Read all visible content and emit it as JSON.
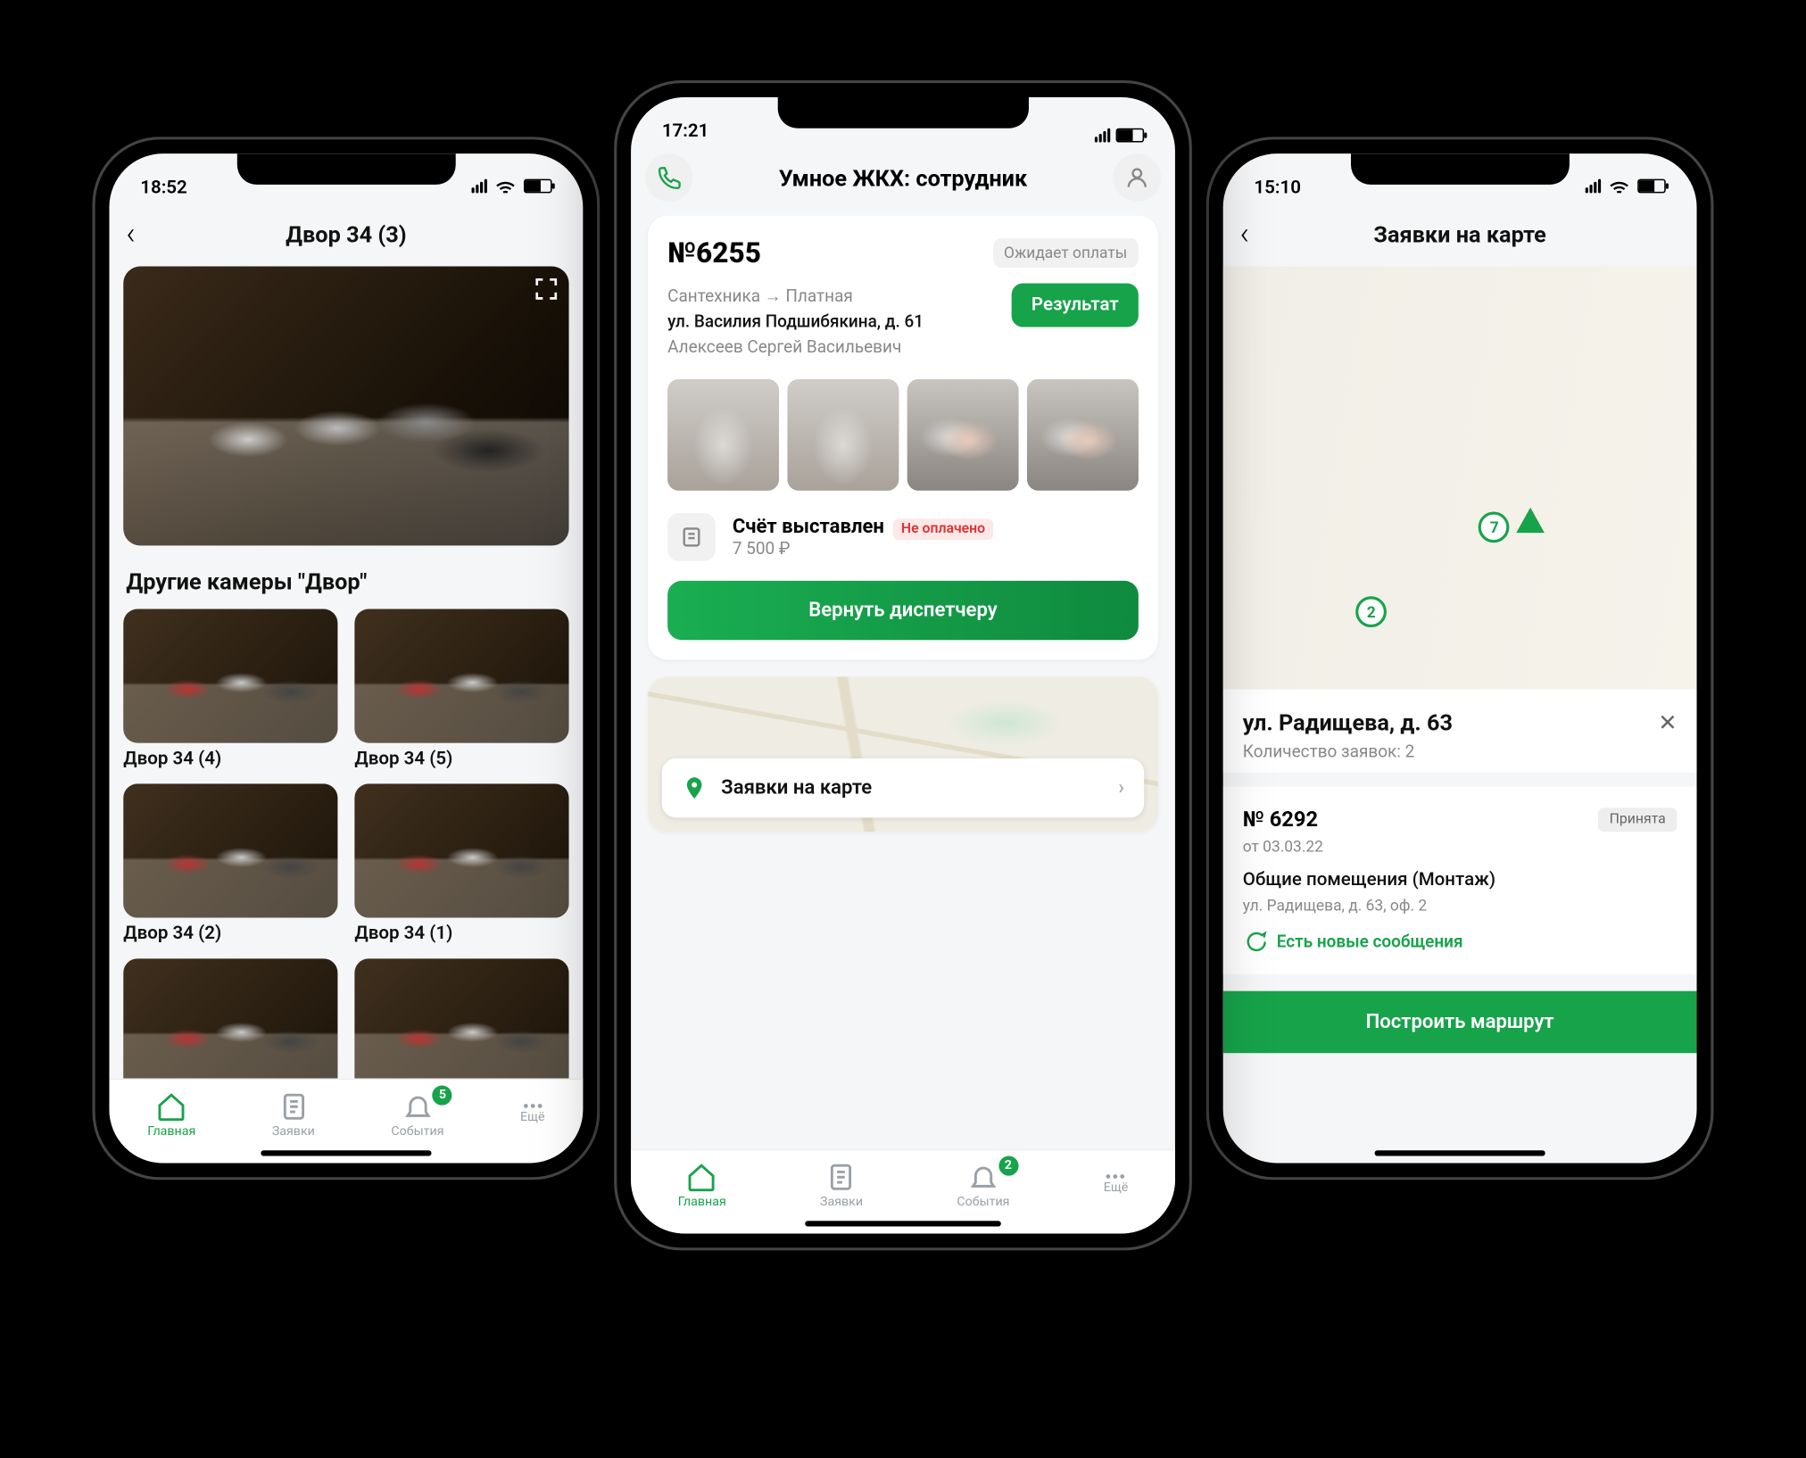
{
  "left": {
    "status_time": "18:52",
    "nav_title": "Двор 34 (3)",
    "section_title": "Другие камеры \"Двор\"",
    "cams": [
      {
        "label": "Двор 34 (4)"
      },
      {
        "label": "Двор 34 (5)"
      },
      {
        "label": "Двор 34 (2)"
      },
      {
        "label": "Двор 34 (1)"
      }
    ],
    "tabs": {
      "home": "Главная",
      "req": "Заявки",
      "events": "События",
      "more": "Ещё",
      "badge": "5"
    }
  },
  "center": {
    "status_time": "17:21",
    "header_title": "Умное ЖКХ: сотрудник",
    "ticket_no": "№6255",
    "ticket_status": "Ожидает оплаты",
    "category_line": "Сантехника → Платная",
    "address": "ул. Василия Подшибякина, д. 61",
    "person": "Алексеев Сергей Васильевич",
    "result_btn": "Результат",
    "bill_title": "Счёт выставлен",
    "bill_amount": "7 500 ₽",
    "bill_badge": "Не оплачено",
    "return_btn": "Вернуть диспетчеру",
    "map_btn": "Заявки на карте",
    "tabs": {
      "home": "Главная",
      "req": "Заявки",
      "events": "События",
      "more": "Ещё",
      "badge": "2"
    }
  },
  "right": {
    "status_time": "15:10",
    "nav_title": "Заявки на карте",
    "map_markers": [
      "7",
      "2"
    ],
    "addr_title": "ул. Радищева, д. 63",
    "addr_sub": "Количество заявок: 2",
    "req_no": "№ 6292",
    "req_status": "Принята",
    "req_date": "от 03.03.22",
    "req_cat": "Общие помещения (Монтаж)",
    "req_addr": "ул. Радищева, д. 63, оф. 2",
    "msg_text": "Есть новые сообщения",
    "route_btn": "Построить маршрут"
  }
}
